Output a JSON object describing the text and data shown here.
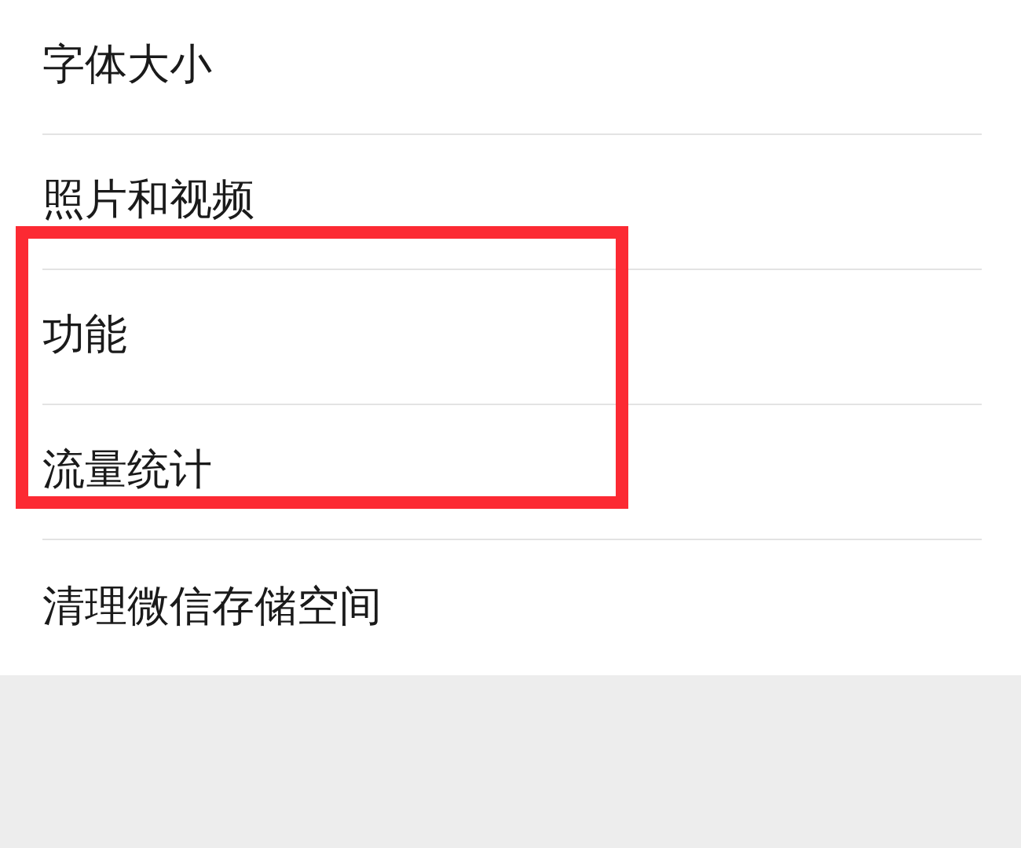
{
  "settings_items": [
    {
      "label": "字体大小"
    },
    {
      "label": "照片和视频"
    },
    {
      "label": "功能"
    },
    {
      "label": "流量统计"
    },
    {
      "label": "清理微信存储空间"
    }
  ],
  "highlight_box": {
    "kind": "rectangle"
  }
}
